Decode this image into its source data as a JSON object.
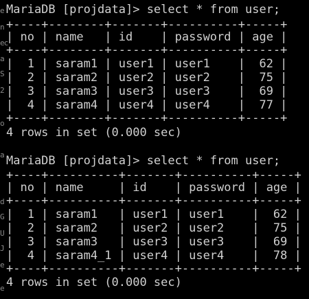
{
  "left_edge_fragments": [
    "e",
    "n",
    "ec",
    "a",
    "S",
    "2",
    "o",
    "a",
    "d",
    "G",
    "U",
    "J",
    "e",
    "e"
  ],
  "queries": [
    {
      "prompt": "MariaDB [projdata]> select * from user;",
      "border": "+----+--------+-------+----------+-----+",
      "header": "| no | name   | id    | password | age |",
      "rows": [
        "|  1 | saram1 | user1 | user1    |  62 |",
        "|  2 | saram2 | user2 | user2    |  75 |",
        "|  3 | saram3 | user3 | user3    |  69 |",
        "|  4 | saram4 | user4 | user4    |  77 |"
      ],
      "result": "4 rows in set (0.000 sec)"
    },
    {
      "prompt": "MariaDB [projdata]> select * from user;",
      "border": "+----+----------+-------+----------+-----+",
      "header": "| no | name     | id    | password | age |",
      "rows": [
        "|  1 | saram1   | user1 | user1    |  62 |",
        "|  2 | saram2   | user2 | user2    |  75 |",
        "|  3 | saram3   | user3 | user3    |  69 |",
        "|  4 | saram4_1 | user4 | user4    |  78 |"
      ],
      "result": "4 rows in set (0.000 sec)"
    }
  ]
}
